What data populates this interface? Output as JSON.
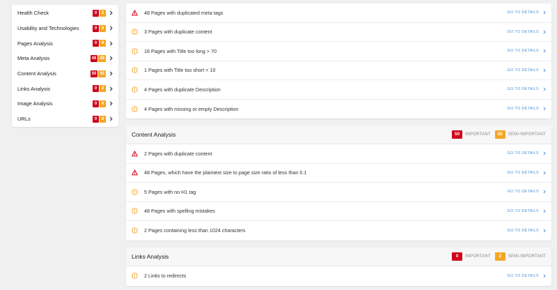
{
  "sidebar": {
    "items": [
      {
        "label": "Health Check",
        "red": "0",
        "orange": "2"
      },
      {
        "label": "Usability and Technologies",
        "red": "0",
        "orange": "0"
      },
      {
        "label": "Pages Analysis",
        "red": "0",
        "orange": "9"
      },
      {
        "label": "Meta Analysis",
        "red": "48",
        "orange": "28"
      },
      {
        "label": "Content Analysis",
        "red": "50",
        "orange": "55"
      },
      {
        "label": "Links Analysis",
        "red": "0",
        "orange": "2"
      },
      {
        "label": "Image Analysis",
        "red": "0",
        "orange": "0"
      },
      {
        "label": "URLs",
        "red": "0",
        "orange": "0"
      }
    ]
  },
  "meta_card": {
    "rows": [
      {
        "icon": "warning-icon",
        "text": "48 Pages with duplicated meta tags",
        "link": "GO TO DETAILS"
      },
      {
        "icon": "info-circle-icon",
        "text": "3 Pages with duplicate content",
        "link": "GO TO DETAILS"
      },
      {
        "icon": "info-circle-icon",
        "text": "16 Pages with Title too long > 70",
        "link": "GO TO DETAILS"
      },
      {
        "icon": "info-circle-icon",
        "text": "1 Pages with Title too short < 10",
        "link": "GO TO DETAILS"
      },
      {
        "icon": "info-circle-icon",
        "text": "4 Pages with duplicate Description",
        "link": "GO TO DETAILS"
      },
      {
        "icon": "info-circle-icon",
        "text": "4 Pages with missing or empty Description",
        "link": "GO TO DETAILS"
      }
    ]
  },
  "content_card": {
    "title": "Content Analysis",
    "important_count": "50",
    "important_label": "IMPORTANT",
    "semi_count": "55",
    "semi_label": "SEMI-IMPORTANT",
    "rows": [
      {
        "icon": "warning-icon",
        "text": "2 Pages with duplicate content",
        "link": "GO TO DETAILS"
      },
      {
        "icon": "warning-icon",
        "text": "48 Pages, which have the plaintext size to page size ratio of less than 0.1",
        "link": "GO TO DETAILS"
      },
      {
        "icon": "info-circle-icon",
        "text": "5 Pages with no H1 tag",
        "link": "GO TO DETAILS"
      },
      {
        "icon": "info-circle-icon",
        "text": "48 Pages with spelling mistakes",
        "link": "GO TO DETAILS"
      },
      {
        "icon": "info-circle-icon",
        "text": "2 Pages containing less than 1024 characters",
        "link": "GO TO DETAILS"
      }
    ]
  },
  "links_card": {
    "title": "Links Analysis",
    "important_count": "0",
    "important_label": "IMPORTANT",
    "semi_count": "2",
    "semi_label": "SEMI-IMPORTANT",
    "rows": [
      {
        "icon": "info-circle-icon",
        "text": "2 Links to redirects",
        "link": "GO TO DETAILS"
      }
    ]
  },
  "colors": {
    "important": "#d0021b",
    "semi_important": "#f5a623",
    "link": "#4a90d9"
  }
}
